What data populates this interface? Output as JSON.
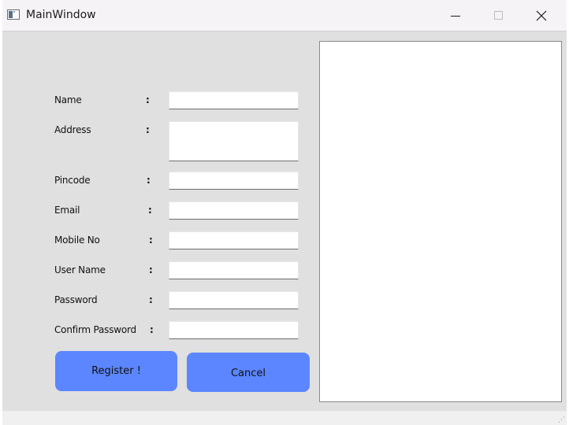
{
  "window": {
    "title": "MainWindow"
  },
  "form": {
    "name_label": "Name",
    "address_label": "Address",
    "pincode_label": "Pincode",
    "email_label": "Email",
    "mobile_label": "Mobile No",
    "username_label": "User Name",
    "password_label": "Password",
    "confirm_password_label": "Confirm Password",
    "separator": ":",
    "name_value": "",
    "address_value": "",
    "pincode_value": "",
    "email_value": "",
    "mobile_value": "",
    "username_value": "",
    "password_value": "",
    "confirm_password_value": ""
  },
  "buttons": {
    "register_label": "Register !",
    "cancel_label": "Cancel"
  },
  "colors": {
    "button_blue": "#5b86ff",
    "window_bg": "#e0e0e0"
  },
  "icons": {
    "app": "window-app-icon",
    "minimize": "minimize-icon",
    "maximize": "maximize-icon",
    "close": "close-icon"
  }
}
